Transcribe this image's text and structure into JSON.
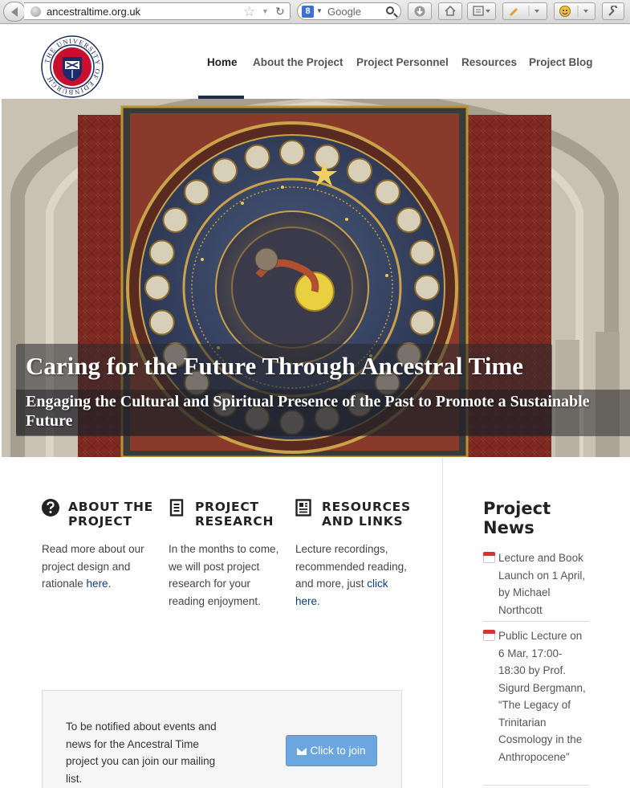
{
  "browser": {
    "url": "ancestraltime.org.uk",
    "search_engine_letter": "8",
    "search_placeholder": "Google"
  },
  "logo": {
    "text": "THE UNIVERSITY OF EDINBURGH"
  },
  "nav": {
    "items": [
      {
        "label": "Home",
        "active": true
      },
      {
        "label": "About the Project"
      },
      {
        "label": "Project Personnel"
      },
      {
        "label": "Resources"
      },
      {
        "label": "Project Blog"
      }
    ]
  },
  "hero": {
    "title": "Caring for the Future Through Ancestral Time",
    "subtitle": "Engaging the Cultural and Spiritual Presence of the Past to Promote a Sustainable Future"
  },
  "features": [
    {
      "icon": "question-icon",
      "heading_line1": "ABOUT THE",
      "heading_line2": "PROJECT",
      "text": "Read more about our project design and rationale ",
      "link": "here",
      "text_after": "."
    },
    {
      "icon": "document-icon",
      "heading_line1": "PROJECT",
      "heading_line2": "RESEARCH",
      "text": "In the months to come, we will post project research for your reading enjoyment."
    },
    {
      "icon": "newspaper-icon",
      "heading_line1": "RESOURCES",
      "heading_line2": "AND LINKS",
      "text": "Lecture recordings, recommended reading, and more, just ",
      "link": "click here",
      "text_after": "."
    }
  ],
  "mailing": {
    "text": "To be notified about events and news for the Ancestral Time project you can join our mailing list.",
    "button_label": "Click to join"
  },
  "news": {
    "title": "Project News",
    "items": [
      {
        "text": "Lecture and Book Launch on 1 April, by Michael Northcott"
      },
      {
        "text": "Public Lecture on 6 Mar, 17:00-18:30 by Prof. Sigurd Bergmann, “The Legacy of Trinitarian Cosmology in the Anthropocene”"
      }
    ]
  }
}
